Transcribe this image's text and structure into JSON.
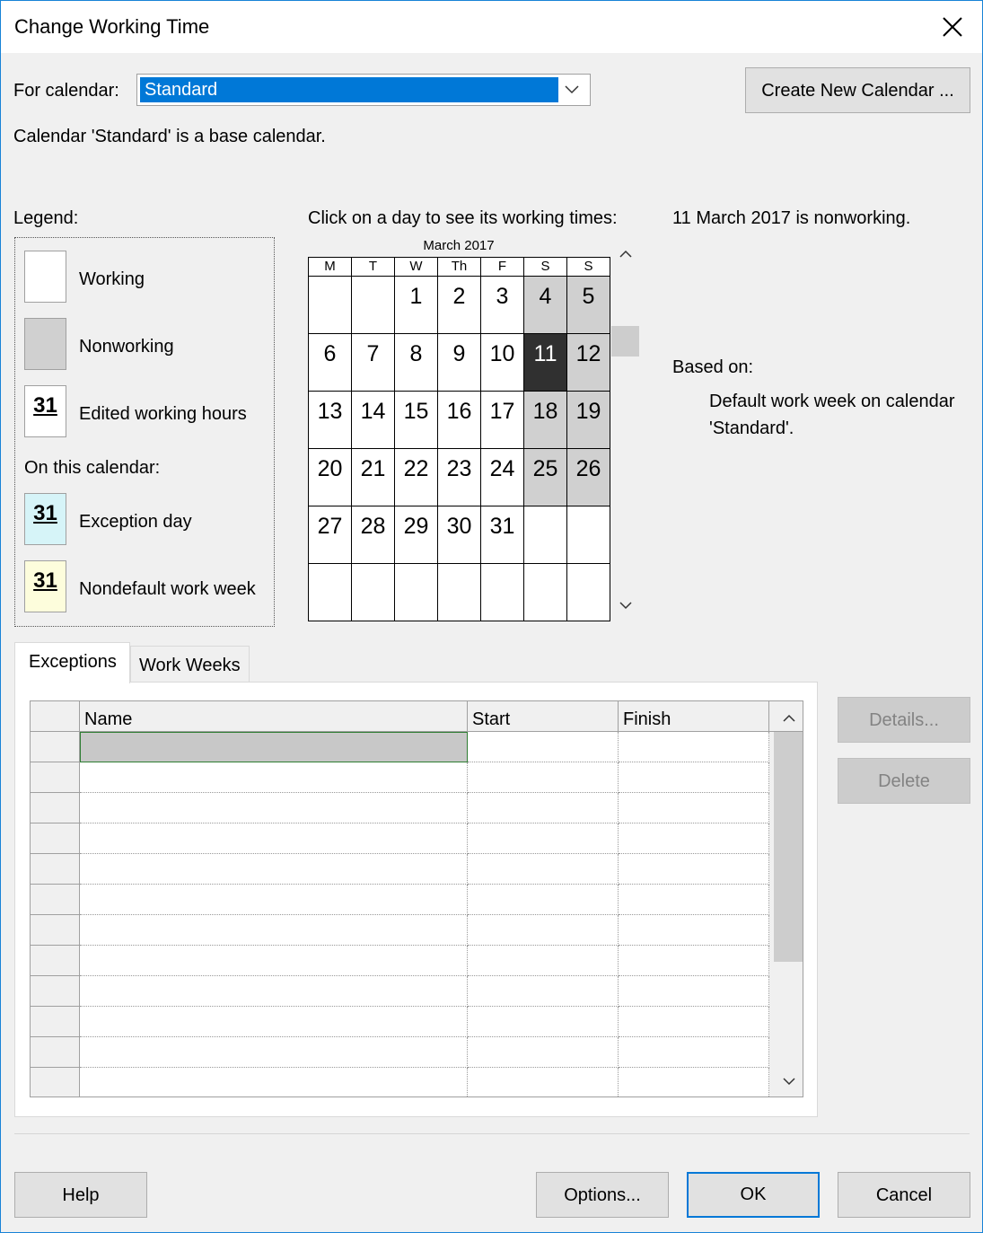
{
  "window": {
    "title": "Change Working Time"
  },
  "for_calendar": {
    "label": "For calendar:",
    "selected": "Standard"
  },
  "create_new_calendar_label": "Create New Calendar ...",
  "base_calendar_note": "Calendar 'Standard' is a base calendar.",
  "legend": {
    "label": "Legend:",
    "items": [
      {
        "label": "Working",
        "number": ""
      },
      {
        "label": "Nonworking",
        "number": ""
      },
      {
        "label": "Edited working hours",
        "number": "31"
      }
    ],
    "on_this_calendar_label": "On this calendar:",
    "calendar_items": [
      {
        "label": "Exception day",
        "number": "31"
      },
      {
        "label": "Nondefault work week",
        "number": "31"
      }
    ]
  },
  "calendar": {
    "instruction": "Click on a day to see its working times:",
    "month_label": "March 2017",
    "weekday_headers": [
      "M",
      "T",
      "W",
      "Th",
      "F",
      "S",
      "S"
    ],
    "weeks": [
      [
        "",
        "",
        "1",
        "2",
        "3",
        "4",
        "5"
      ],
      [
        "6",
        "7",
        "8",
        "9",
        "10",
        "11",
        "12"
      ],
      [
        "13",
        "14",
        "15",
        "16",
        "17",
        "18",
        "19"
      ],
      [
        "20",
        "21",
        "22",
        "23",
        "24",
        "25",
        "26"
      ],
      [
        "27",
        "28",
        "29",
        "30",
        "31",
        "",
        ""
      ],
      [
        "",
        "",
        "",
        "",
        "",
        "",
        ""
      ]
    ],
    "nonworking_days": [
      "4",
      "5",
      "12",
      "18",
      "19",
      "25",
      "26"
    ],
    "selected_day": "11"
  },
  "status": {
    "day_status": "11 March 2017 is nonworking.",
    "based_on_label": "Based on:",
    "based_on_line1": "Default work week on calendar",
    "based_on_line2": "'Standard'."
  },
  "tabs": [
    {
      "label": "Exceptions",
      "active": true
    },
    {
      "label": "Work Weeks",
      "active": false
    }
  ],
  "exceptions_table": {
    "columns": [
      "Name",
      "Start",
      "Finish"
    ],
    "row_count": 12
  },
  "side_buttons": {
    "details": "Details...",
    "delete": "Delete"
  },
  "footer": {
    "help": "Help",
    "options": "Options...",
    "ok": "OK",
    "cancel": "Cancel"
  },
  "colors": {
    "selection": "#0078d7",
    "nonworking": "#d0d0d0",
    "selected_day": "#303030",
    "exception_swatch": "#d6f4f8",
    "nondefault_swatch": "#fdfddc"
  }
}
